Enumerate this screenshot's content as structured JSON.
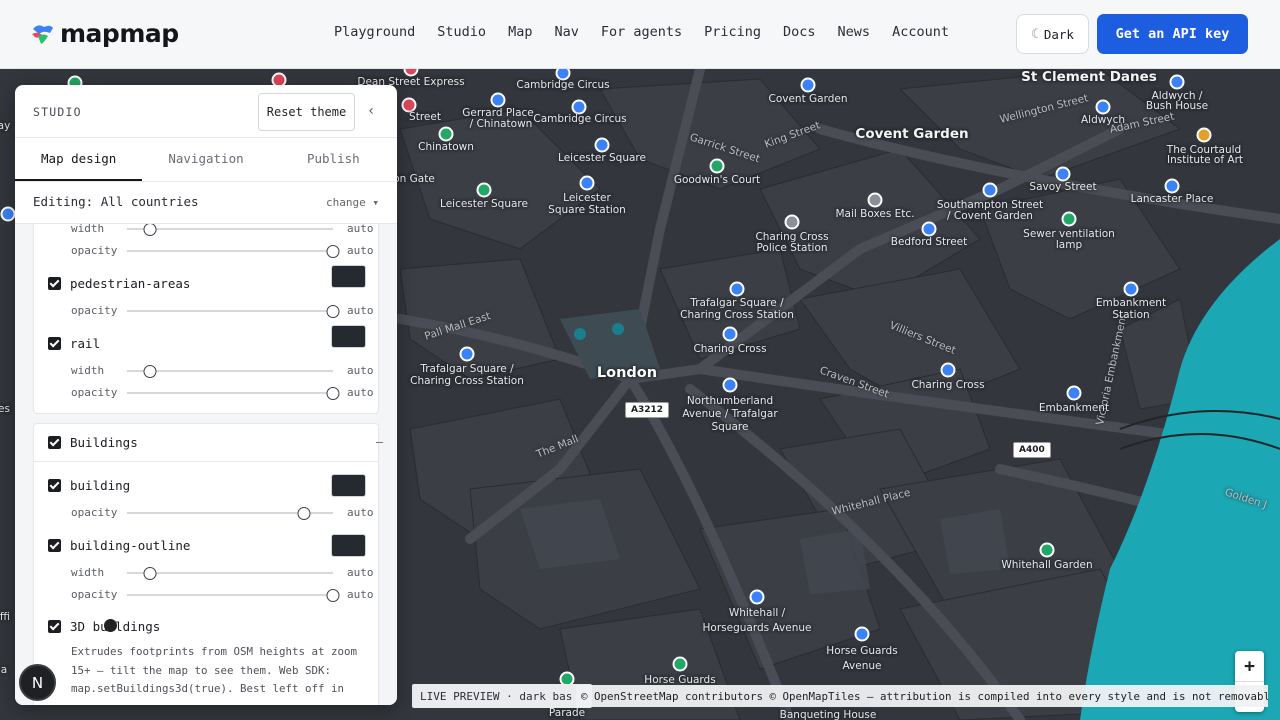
{
  "header": {
    "logo_text": "mapmap",
    "nav": [
      "Playground",
      "Studio",
      "Map",
      "Nav",
      "For agents",
      "Pricing",
      "Docs",
      "News",
      "Account"
    ],
    "theme_label": "Dark",
    "api_button": "Get an API key"
  },
  "studio": {
    "title": "STUDIO",
    "reset_label": "Reset theme",
    "collapse_icon": "chevron-left-icon",
    "tabs": [
      "Map design",
      "Navigation",
      "Publish"
    ],
    "editing_text": "Editing: All countries",
    "change_label": "change ▾",
    "layers": {
      "width_label": "width",
      "opacity_label": "opacity",
      "auto_label": "auto",
      "pedestrian": "pedestrian-areas",
      "rail": "rail",
      "section_buildings": "Buildings",
      "section_toggle": "–",
      "building": "building",
      "building_outline": "building-outline",
      "buildings_3d": "3D buildings",
      "buildings_3d_desc": "Extrudes footprints from OSM heights at zoom 15+ — tilt the map to see them. Web SDK: map.setBuildings3d(true). Best left off in",
      "swatch_color": "#252a31"
    }
  },
  "map": {
    "city": "London",
    "labels": {
      "st_clement": "St Clement Danes",
      "covent_garden": "Covent Garden",
      "cambridge_circus": "Cambridge Circus",
      "cambridge_circus2": "Cambridge Circus",
      "covent_garden_station": "Covent Garden",
      "aldwych_bush": "Aldwych /",
      "aldwych_bush2": "Bush House",
      "aldwych": "Aldwych",
      "dean_street": "Dean Street Express",
      "gerrard1": "Gerrard Place",
      "gerrard2": "/ Chinatown",
      "chinatown": "Chinatown",
      "leicester_square1": "Leicester Square",
      "leicester_square_poi": "Leicester Square",
      "leicester_station1": "Leicester",
      "leicester_station2": "Square Station",
      "goodwins": "Goodwin's Court",
      "courtauld1": "The Courtauld",
      "courtauld2": "Institute of Art",
      "savoy": "Savoy Street",
      "lancaster": "Lancaster Place",
      "southampton1": "Southampton Street",
      "southampton2": "/ Covent Garden",
      "sewer1": "Sewer ventilation",
      "sewer2": "lamp",
      "mailboxes": "Mail Boxes Etc.",
      "bedford": "Bedford Street",
      "charing_police1": "Charing Cross",
      "charing_police2": "Police Station",
      "embankment_station1": "Embankment",
      "embankment_station2": "Station",
      "trafalgar_cc1": "Trafalgar Square /",
      "trafalgar_cc2": "Charing Cross Station",
      "charing_cross": "Charing Cross",
      "charing_cross2": "Charing Cross",
      "trafalgar_left1": "Trafalgar Square /",
      "trafalgar_left2": "Charing Cross Station",
      "northumberland1": "Northumberland",
      "northumberland2": "Avenue / Trafalgar",
      "northumberland3": "Square",
      "embankment": "Embankment",
      "whitehall_garden": "Whitehall Garden",
      "whitehall1": "Whitehall /",
      "whitehall2": "Horseguards Avenue",
      "horse_guards_ave1": "Horse Guards",
      "horse_guards_ave2": "Avenue",
      "horse_guards": "Horse Guards",
      "parade": "Parade",
      "banqueting": "Banqueting House",
      "gate": "on Gate",
      "street_lbl": "Street",
      "lbl_ay": "ay",
      "lbl_es": "es",
      "lbl_ffi": "ffi",
      "lbl_a": "a"
    },
    "streets": {
      "pall_mall": "Pall Mall East",
      "the_mall": "The Mall",
      "whitehall_place": "Whitehall Place",
      "craven": "Craven Street",
      "villiers": "Villiers Street",
      "victoria": "Victoria Embankment",
      "king": "King Street",
      "garrick": "Garrick Street",
      "golden": "Golden J",
      "wellington": "Wellington Street",
      "adam": "Adam Street"
    },
    "road_badges": [
      "A3212",
      "A400"
    ],
    "zoom_in": "+",
    "zoom_out": "−",
    "map_logo": "mapmap",
    "live_preview": "LIVE PREVIEW · dark bas",
    "attribution": "© OpenStreetMap contributors © OpenMapTiles — attribution is compiled into every style and is not removable."
  },
  "avatar_letter": "N",
  "colors": {
    "accent": "#1d5de0",
    "water": "#1ba7b3",
    "map_bg": "#2f3238"
  }
}
